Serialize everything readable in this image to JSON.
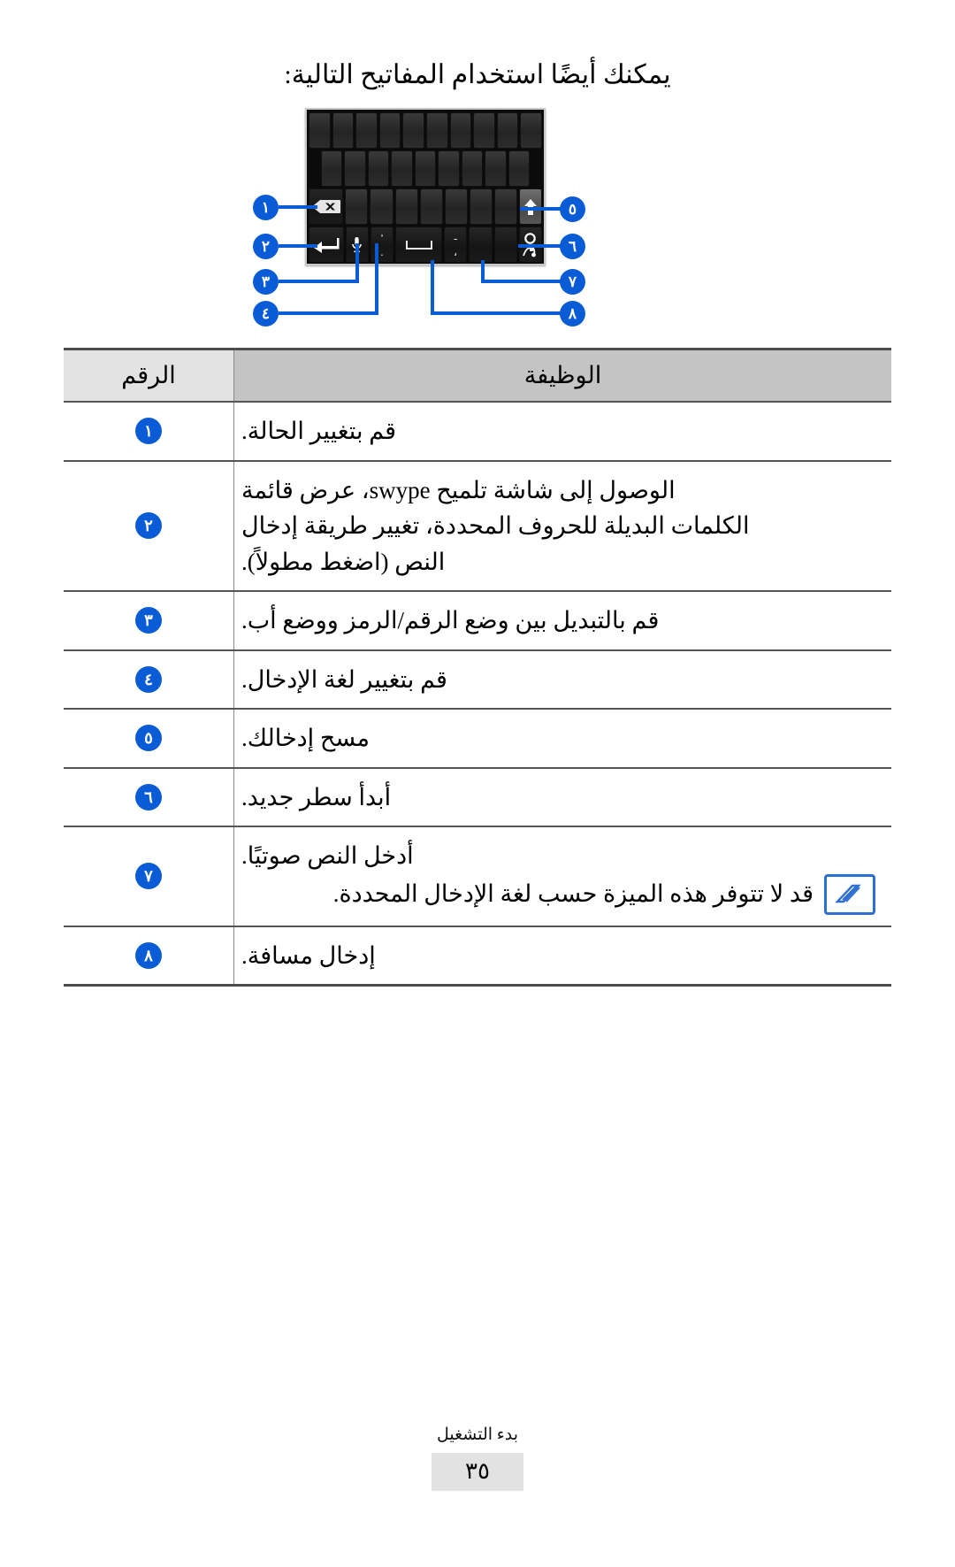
{
  "intro": {
    "text": "يمكنك أيضًا استخدام المفاتيح التالية:"
  },
  "figure": {
    "alt_name": "swype-keyboard-diagram",
    "keys": {
      "shift": "shift-arrow-up",
      "swype_settings": "swype-gear-hand",
      "symbol_mode": "symbol-mode-key",
      "input_language": "input-language-key",
      "punct_dash_comma": "-\n،",
      "punct_apostrophe_period": "'\n.",
      "space": "space-bar",
      "voice": "microphone",
      "backspace": "backspace-x",
      "enter": "enter-return"
    },
    "callouts_left": [
      "١",
      "٢",
      "٣",
      "٤"
    ],
    "callouts_right": [
      "٥",
      "٦",
      "٧",
      "٨"
    ],
    "accent_color": "#0a5cd6"
  },
  "table": {
    "header": {
      "function": "الوظيفة",
      "number": "الرقم"
    },
    "rows": [
      {
        "num": "١",
        "lines": [
          "قم بتغيير الحالة."
        ]
      },
      {
        "num": "٢",
        "lines": [
          "الوصول إلى شاشة تلميح swype، عرض قائمة",
          "الكلمات البديلة للحروف المحددة، تغيير طريقة إدخال",
          "النص (اضغط مطولاً)."
        ]
      },
      {
        "num": "٣",
        "lines": [
          "قم بالتبديل بين وضع الرقم/الرمز ووضع أب."
        ]
      },
      {
        "num": "٤",
        "lines": [
          "قم بتغيير لغة الإدخال."
        ]
      },
      {
        "num": "٥",
        "lines": [
          "مسح إدخالك."
        ]
      },
      {
        "num": "٦",
        "lines": [
          "أبدأ سطر جديد."
        ]
      },
      {
        "num": "٧",
        "lines": [
          "أدخل النص صوتيًا."
        ],
        "note": {
          "icon": "note-pencil-icon",
          "text": "قد لا تتوفر هذه الميزة حسب لغة الإدخال المحددة."
        }
      },
      {
        "num": "٨",
        "lines": [
          "إدخال مسافة."
        ]
      }
    ]
  },
  "footer": {
    "section": "بدء التشغيل",
    "page_number": "٣٥"
  }
}
